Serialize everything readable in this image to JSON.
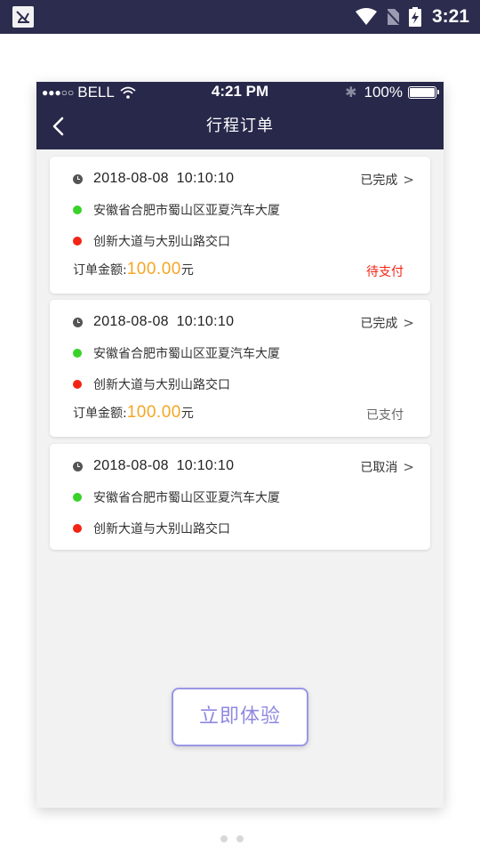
{
  "android_status": {
    "time": "3:21"
  },
  "ios_status": {
    "signal_dots": "●●●○○",
    "carrier": "BELL",
    "time": "4:21 PM",
    "battery_pct": "100%"
  },
  "nav": {
    "title": "行程订单"
  },
  "orders": [
    {
      "datetime": "2018-08-08  10:10:10",
      "status": "已完成",
      "from": "安徽省合肥市蜀山区亚夏汽车大厦",
      "to": "创新大道与大别山路交口",
      "amount_label": "订单金额:",
      "amount": "100.00",
      "currency": "元",
      "pay_status": "待支付"
    },
    {
      "datetime": "2018-08-08  10:10:10",
      "status": "已完成",
      "from": "安徽省合肥市蜀山区亚夏汽车大厦",
      "to": "创新大道与大别山路交口",
      "amount_label": "订单金额:",
      "amount": "100.00",
      "currency": "元",
      "pay_status": "已支付"
    },
    {
      "datetime": "2018-08-08  10:10:10",
      "status": "已取消",
      "from": "安徽省合肥市蜀山区亚夏汽车大厦",
      "to": "创新大道与大别山路交口"
    }
  ],
  "cta": {
    "label": "立即体验"
  },
  "chevron": ">",
  "colors": {
    "header": "#27284a",
    "amount": "#f5a623",
    "unpaid": "#f22414",
    "origin_dot": "#3ad12a",
    "destination_dot": "#f22414",
    "cta": "#8f89e0"
  }
}
